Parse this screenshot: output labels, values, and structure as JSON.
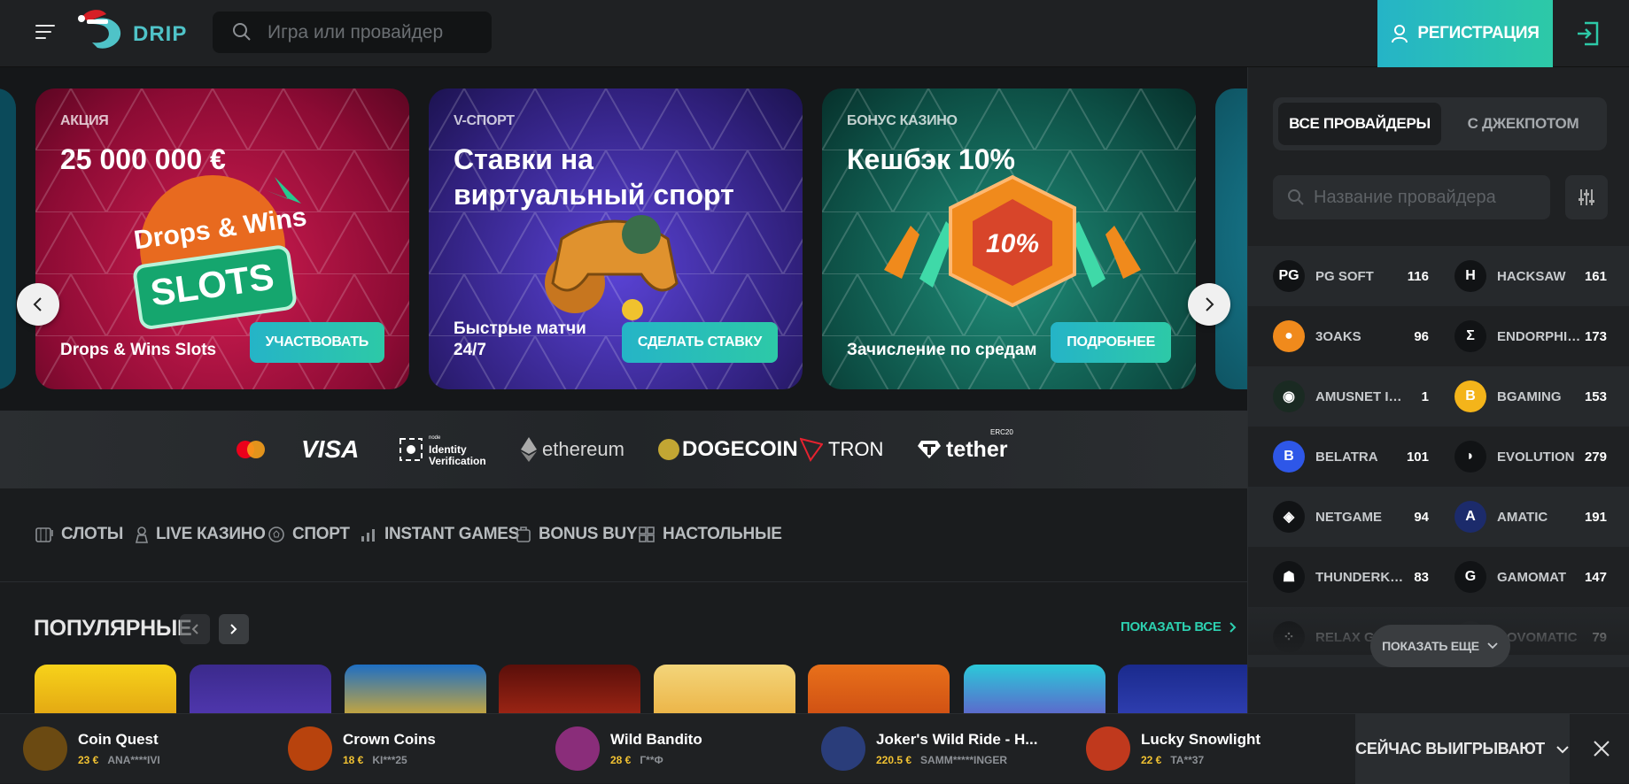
{
  "header": {
    "logo_text": "DRIP",
    "search_placeholder": "Игра или провайдер",
    "register_label": "РЕГИСТРАЦИЯ"
  },
  "banners": [
    {
      "tag": "АКЦИЯ",
      "title": "25 000 000 €",
      "sub": "Drops & Wins Slots",
      "cta": "УЧАСТВОВАТЬ",
      "art_line1": "Drops & Wins",
      "art_line2": "SLOTS"
    },
    {
      "tag": "V-СПОРТ",
      "title": "Ставки на виртуальный спорт",
      "sub": "Быстрые матчи 24/7",
      "cta": "СДЕЛАТЬ СТАВКУ"
    },
    {
      "tag": "БОНУС КАЗИНО",
      "title": "Кешбэк 10%",
      "sub": "Зачисление по средам",
      "cta": "ПОДРОБНЕЕ",
      "art_text": "10%"
    }
  ],
  "payments": [
    "VISA",
    "Identity Verification",
    "ethereum",
    "DOGECOIN",
    "TRON",
    "tether",
    "ERC20",
    "node"
  ],
  "categories": [
    "СЛОТЫ",
    "LIVE КАЗИНО",
    "СПОРТ",
    "INSTANT GAMES",
    "BONUS BUY",
    "НАСТОЛЬНЫЕ"
  ],
  "popular": {
    "title": "ПОПУЛЯРНЫЕ",
    "show_all": "ПОКАЗАТЬ ВСЕ"
  },
  "providers_panel": {
    "tab_all": "ВСЕ ПРОВАЙДЕРЫ",
    "tab_jackpot": "С ДЖЕКПОТОМ",
    "search_placeholder": "Название провайдера",
    "show_more": "ПОКАЗАТЬ ЕЩЕ",
    "rows": [
      [
        {
          "name": "PG SOFT",
          "count": "116",
          "logo": "PG",
          "color": "#111315"
        },
        {
          "name": "HACKSAW",
          "count": "161",
          "logo": "H",
          "color": "#111315"
        }
      ],
      [
        {
          "name": "3OAKS",
          "count": "96",
          "logo": "●",
          "color": "#f08a1c"
        },
        {
          "name": "ENDORPHINA",
          "count": "173",
          "logo": "Σ",
          "color": "#111315"
        }
      ],
      [
        {
          "name": "AMUSNET IN...",
          "count": "1",
          "logo": "◉",
          "color": "#1a2a22"
        },
        {
          "name": "BGAMING",
          "count": "153",
          "logo": "B",
          "color": "#f4b41a"
        }
      ],
      [
        {
          "name": "BELATRA",
          "count": "101",
          "logo": "B",
          "color": "#2e57e8"
        },
        {
          "name": "EVOLUTION",
          "count": "279",
          "logo": "◗",
          "color": "#111315"
        }
      ],
      [
        {
          "name": "NETGAME",
          "count": "94",
          "logo": "◈",
          "color": "#111315"
        },
        {
          "name": "AMATIC",
          "count": "191",
          "logo": "A",
          "color": "#1c2b6b"
        }
      ],
      [
        {
          "name": "THUNDERKICK",
          "count": "83",
          "logo": "☗",
          "color": "#111315"
        },
        {
          "name": "GAMOMAT",
          "count": "147",
          "logo": "G",
          "color": "#111315"
        }
      ],
      [
        {
          "name": "RELAX GAM...",
          "count": "",
          "logo": "⁘",
          "color": "#111315"
        },
        {
          "name": "NOVOMATIC",
          "count": "79",
          "logo": "◐",
          "color": "#2a2d30"
        }
      ]
    ]
  },
  "ticker": {
    "now_winning": "СЕЙЧАС ВЫИГРЫВАЮТ",
    "wins": [
      {
        "game": "Coin Quest",
        "amount": "23 €",
        "user": "ANA****IVI",
        "color": "#6b4a12"
      },
      {
        "game": "Crown Coins",
        "amount": "18 €",
        "user": "KI***25",
        "color": "#b8430d"
      },
      {
        "game": "Wild Bandito",
        "amount": "28 €",
        "user": "Г**Ф",
        "color": "#8a2d7a"
      },
      {
        "game": "Joker's Wild Ride - H...",
        "amount": "220.5 €",
        "user": "SAMM*****INGER",
        "color": "#2a3d7a"
      },
      {
        "game": "Lucky Snowlight",
        "amount": "22 €",
        "user": "TA**37",
        "color": "#c0391d"
      }
    ]
  }
}
